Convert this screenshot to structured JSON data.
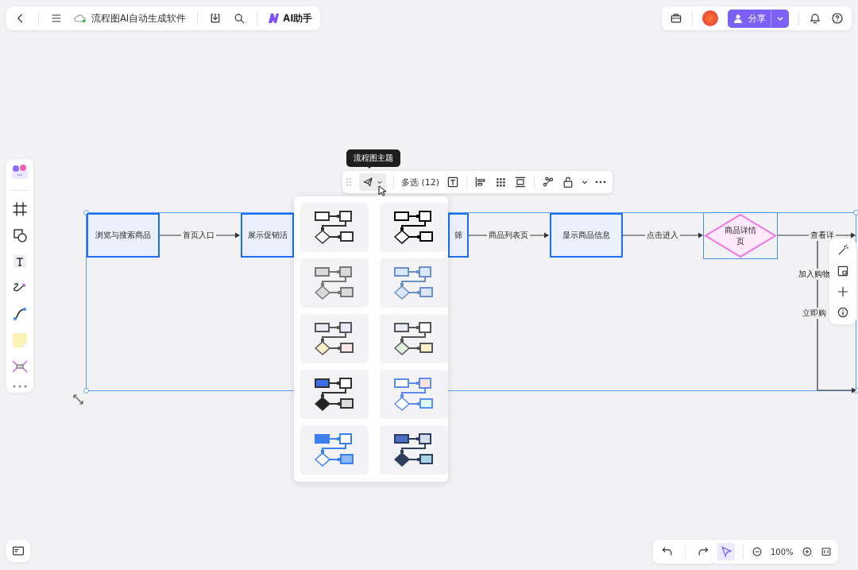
{
  "document": {
    "title": "流程图AI自动生成软件",
    "ai_label": "AI助手"
  },
  "share": {
    "label": "分享"
  },
  "tooltip": "流程图主题",
  "selection_toolbar": {
    "label": "多选 (12)",
    "theme_open": true
  },
  "nodes": [
    {
      "kind": "process",
      "label": "浏览与搜索商品",
      "selected": false
    },
    {
      "kind": "process",
      "label": "展示促销活",
      "selected": false
    },
    {
      "kind": "process",
      "label": "筛",
      "selected": false
    },
    {
      "kind": "process",
      "label": "显示商品信息",
      "selected": false
    },
    {
      "kind": "decision",
      "label": "商品详情页",
      "selected": true
    }
  ],
  "edge_labels": [
    "首页入口",
    "商品列表页",
    "点击进入",
    "查看详",
    "加入购物",
    "立即购"
  ],
  "themes": [
    {
      "color": "#333333",
      "shapes": [
        {
          "color": "#ffffff"
        },
        {
          "color": "#ffffff"
        },
        {
          "color": "#ffffff"
        },
        {
          "color": "#ffffff"
        }
      ]
    },
    {
      "color": "#000000",
      "shapes": [
        {
          "color": "#ffffff"
        },
        {
          "color": "#ffffff"
        },
        {
          "color": "#ffffff"
        },
        {
          "color": "#ffffff"
        }
      ]
    },
    {
      "color": "#777777",
      "shapes": [
        {
          "color": "#d9d9d9"
        },
        {
          "color": "#d9d9d9"
        },
        {
          "color": "#d9d9d9"
        },
        {
          "color": "#d9d9d9"
        }
      ]
    },
    {
      "color": "#6a8fc9",
      "shapes": [
        {
          "color": "#dbe8fb"
        },
        {
          "color": "#dbe8fb"
        },
        {
          "color": "#dbe8fb"
        },
        {
          "color": "#dbe8fb"
        }
      ]
    },
    {
      "color": "#555555",
      "shapes": [
        {
          "color": "#e8ecf7"
        },
        {
          "color": "#ece8fb"
        },
        {
          "color": "#fbf0c8"
        },
        {
          "color": "#fce6e6"
        }
      ]
    },
    {
      "color": "#555555",
      "shapes": [
        {
          "color": "#e8ecf7"
        },
        {
          "color": "#ffffff"
        },
        {
          "color": "#e2f1e2"
        },
        {
          "color": "#fbf0c8"
        }
      ]
    },
    {
      "color": "#333333",
      "shapes": [
        {
          "color": "#3d6ee8"
        },
        {
          "color": "#ffffff"
        },
        {
          "color": "#222222"
        },
        {
          "color": "#dddddd"
        }
      ]
    },
    {
      "color": "#5b8def",
      "shapes": [
        {
          "color": "#ffffff"
        },
        {
          "color": "#fde2de"
        },
        {
          "color": "#ffffff"
        },
        {
          "color": "#e0f7f2"
        }
      ]
    },
    {
      "color": "#3b7ff0",
      "shapes": [
        {
          "color": "#3b7ff0"
        },
        {
          "color": "#ffffff"
        },
        {
          "color": "#ffffff"
        },
        {
          "color": "#8cb8f5"
        }
      ]
    },
    {
      "color": "#2e3f5e",
      "shapes": [
        {
          "color": "#4a6fc4"
        },
        {
          "color": "#d6deea"
        },
        {
          "color": "#2e3f5e"
        },
        {
          "color": "#a9d4e6"
        }
      ]
    }
  ],
  "zoom": {
    "level_text": "100%"
  }
}
